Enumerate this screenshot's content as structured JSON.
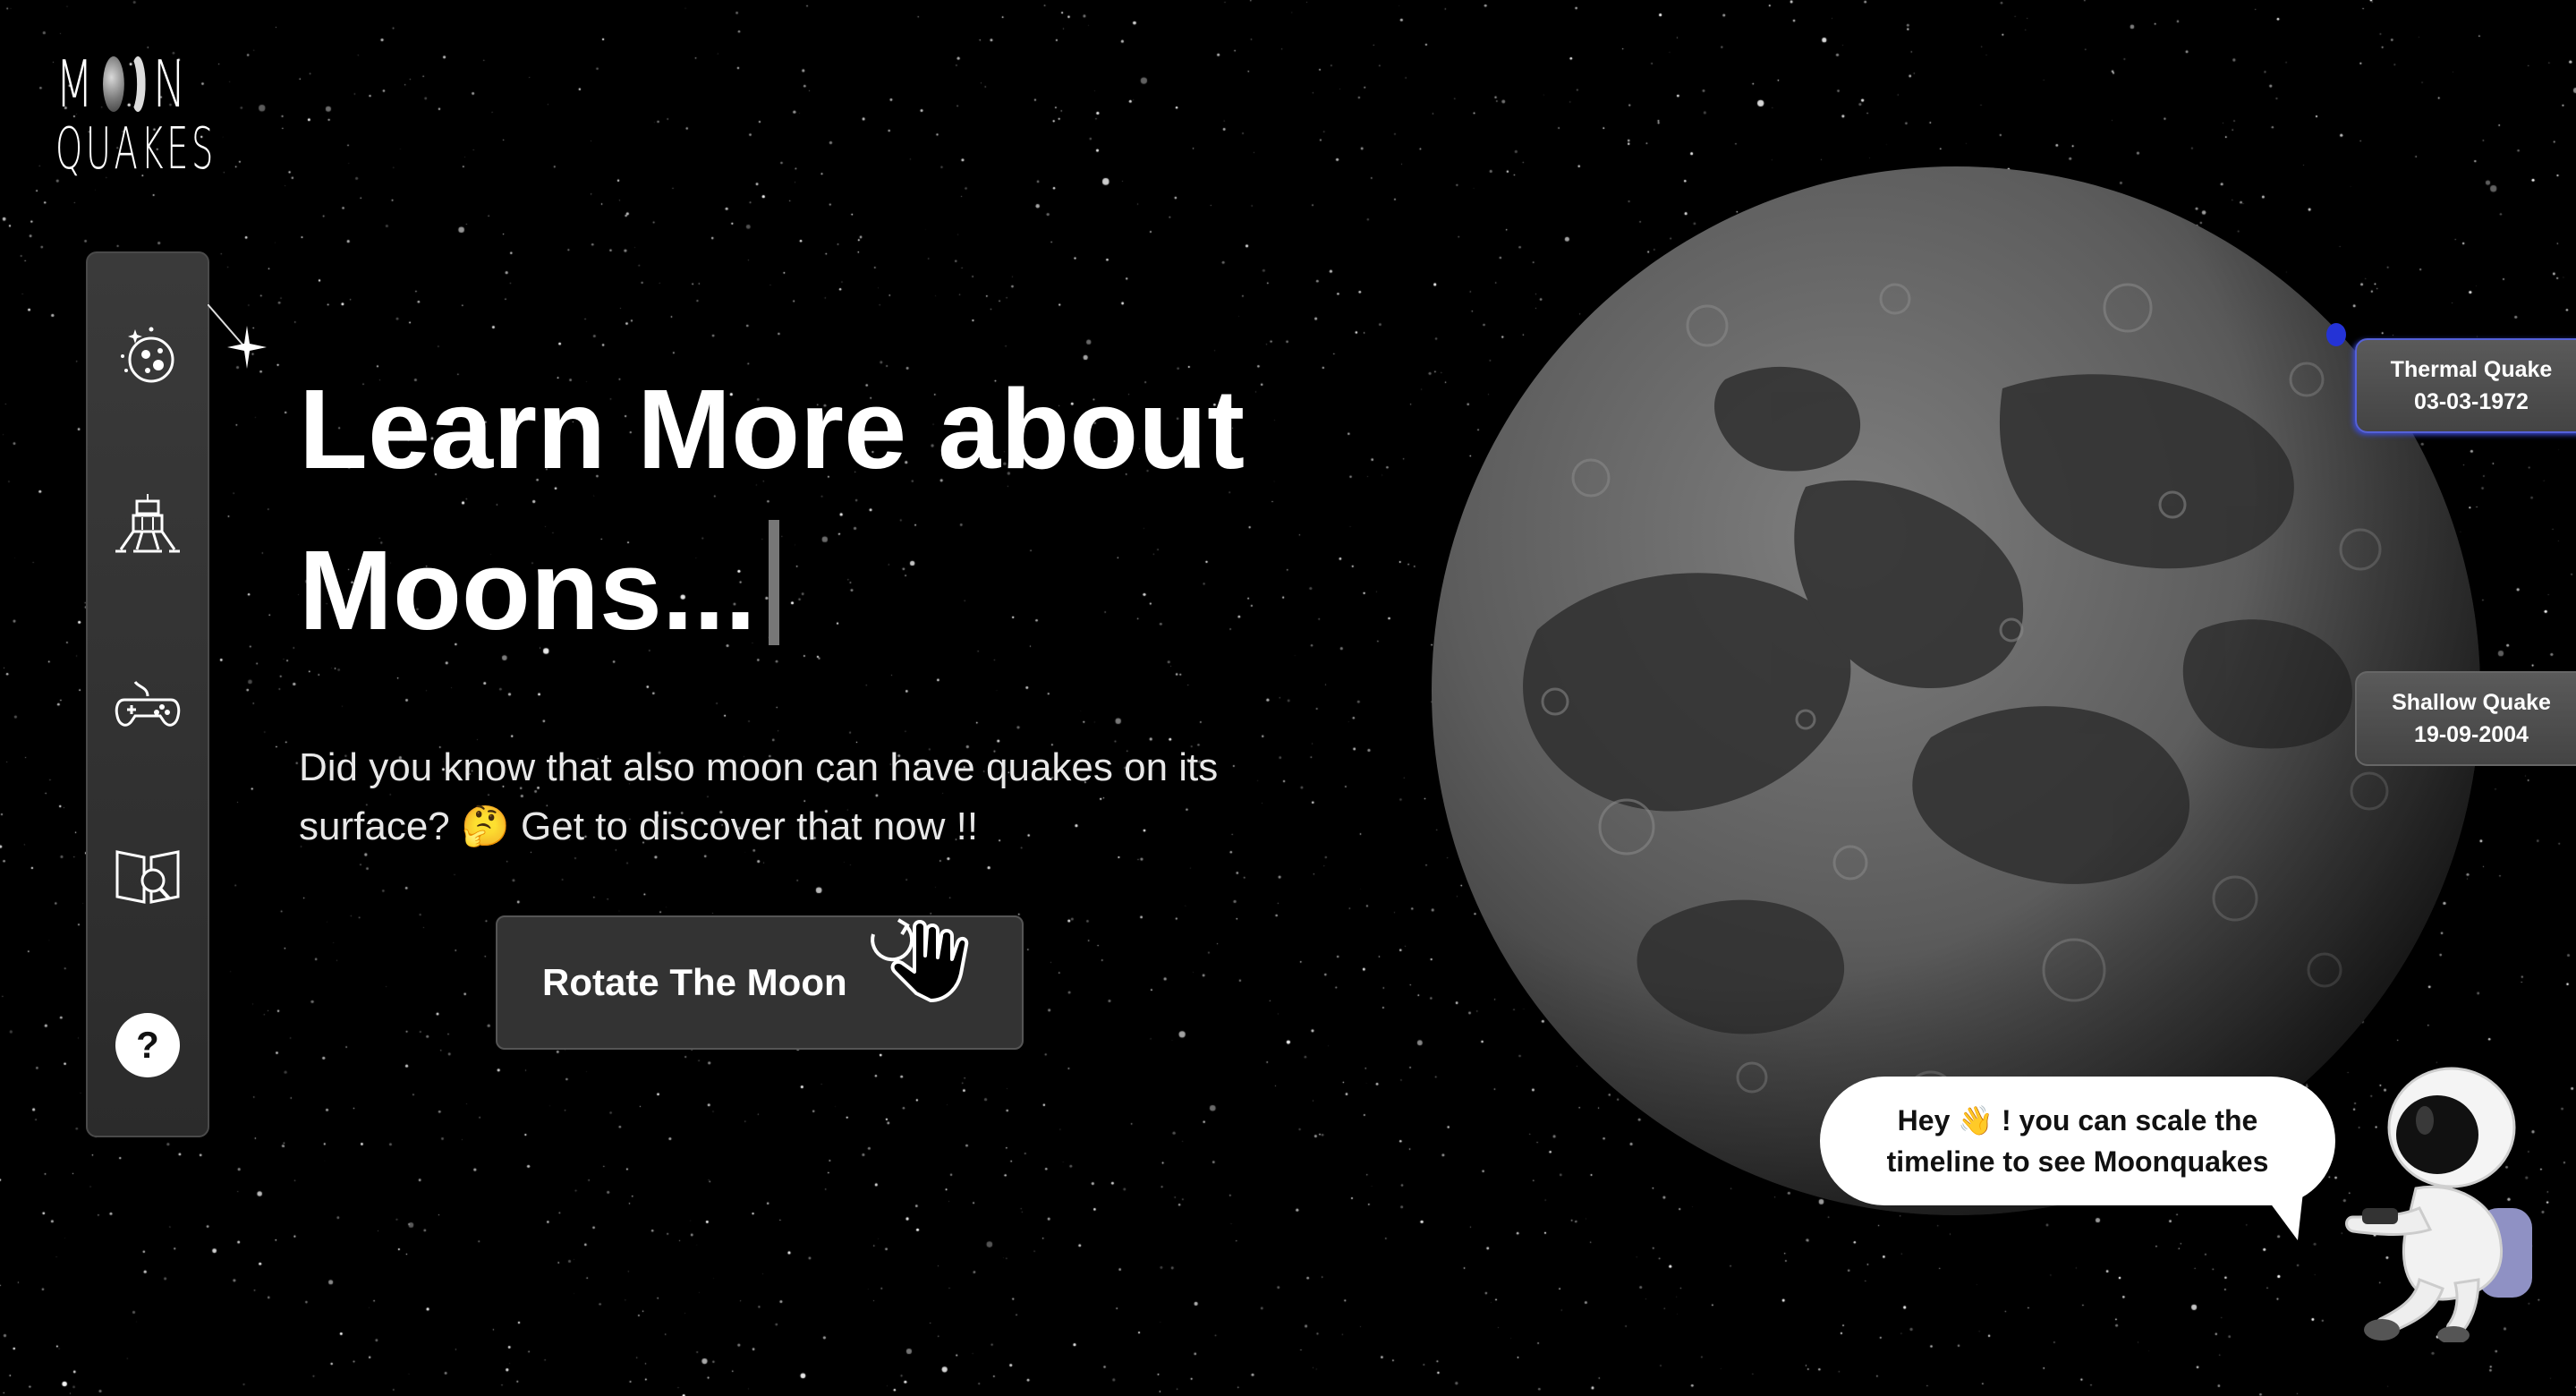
{
  "logo": {
    "line1_left": "M",
    "line1_right": "N",
    "line2": "QUAKES"
  },
  "sidebar": {
    "items": [
      {
        "icon": "moon-stars-icon"
      },
      {
        "icon": "lunar-lander-icon"
      },
      {
        "icon": "gamepad-icon"
      },
      {
        "icon": "book-search-icon"
      },
      {
        "icon": "help-icon",
        "label": "?"
      }
    ]
  },
  "hero": {
    "title_line1": "Learn More about",
    "title_line2": "Moons...",
    "description": "Did you know that also moon can have quakes on its surface? 🤔 Get to discover that now !!",
    "button_label": "Rotate The Moon"
  },
  "quakes": [
    {
      "type": "Thermal Quake",
      "date": "03-03-1972"
    },
    {
      "type": "Shallow Quake",
      "date": "19-09-2004"
    }
  ],
  "assistant": {
    "message_line1": "Hey 👋 ! you can scale the",
    "message_line2": "timeline to see Moonquakes"
  },
  "colors": {
    "background": "#000000",
    "panel": "#333333",
    "marker": "#2433d6"
  }
}
